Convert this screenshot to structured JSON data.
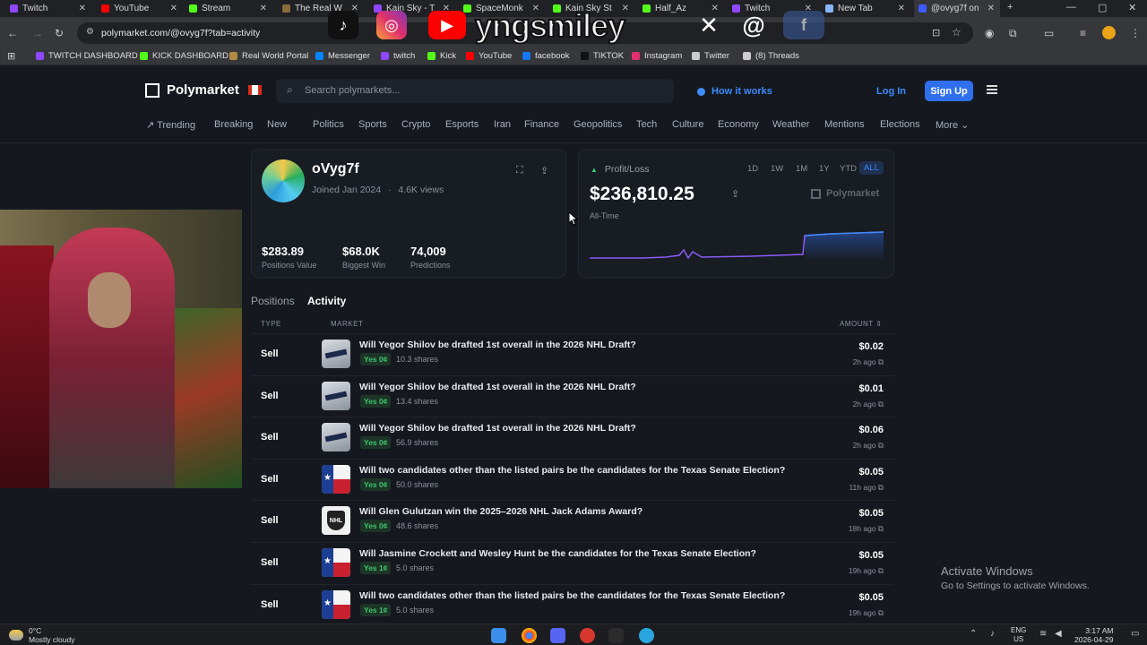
{
  "browser": {
    "tabs": [
      {
        "label": "Twitch",
        "color": "#9146ff"
      },
      {
        "label": "YouTube",
        "color": "#ff0000"
      },
      {
        "label": "Stream",
        "color": "#53fc18"
      },
      {
        "label": "The Real W",
        "color": "#8a6d3b"
      },
      {
        "label": "Kain Sky - T",
        "color": "#9146ff"
      },
      {
        "label": "SpaceMonk",
        "color": "#53fc18"
      },
      {
        "label": "Kain Sky St",
        "color": "#53fc18"
      },
      {
        "label": "Half_Az",
        "color": "#53fc18"
      },
      {
        "label": "Twitch",
        "color": "#9146ff"
      },
      {
        "label": "New Tab",
        "color": "#8ab4f8"
      },
      {
        "label": "@ovyg7f on",
        "color": "#3d5afe"
      }
    ],
    "url": "polymarket.com/@ovyg7f?tab=activity",
    "overlay_text": "yngsmiley",
    "bookmarks": [
      {
        "label": "TWITCH DASHBOARD",
        "color": "#9146ff"
      },
      {
        "label": "KICK DASHBOARD",
        "color": "#53fc18"
      },
      {
        "label": "Real World Portal",
        "color": "#b08a3e"
      },
      {
        "label": "Messenger",
        "color": "#0084ff"
      },
      {
        "label": "twitch",
        "color": "#9146ff"
      },
      {
        "label": "Kick",
        "color": "#53fc18"
      },
      {
        "label": "YouTube",
        "color": "#ff0000"
      },
      {
        "label": "facebook",
        "color": "#1877f2"
      },
      {
        "label": "TIKTOK",
        "color": "#111111"
      },
      {
        "label": "Instagram",
        "color": "#e1306c"
      },
      {
        "label": "Twitter",
        "color": "#cccccc"
      },
      {
        "label": "(8) Threads",
        "color": "#cccccc"
      }
    ]
  },
  "site": {
    "brand": "Polymarket",
    "search_placeholder": "Search polymarkets...",
    "how_it_works": "How it works",
    "login": "Log In",
    "signup": "Sign Up",
    "categories": [
      "Trending",
      "Breaking",
      "New",
      "Politics",
      "Sports",
      "Crypto",
      "Esports",
      "Iran",
      "Finance",
      "Geopolitics",
      "Tech",
      "Culture",
      "Economy",
      "Weather",
      "Mentions",
      "Elections",
      "More"
    ]
  },
  "profile": {
    "name": "oVyg7f",
    "joined": "Joined Jan 2024",
    "views": "4.6K views",
    "stats": [
      {
        "value": "$283.89",
        "label": "Positions Value"
      },
      {
        "value": "$68.0K",
        "label": "Biggest Win"
      },
      {
        "value": "74,009",
        "label": "Predictions"
      }
    ]
  },
  "pnl": {
    "title": "Profit/Loss",
    "ranges": [
      "1D",
      "1W",
      "1M",
      "1Y",
      "YTD",
      "ALL"
    ],
    "selected_range": "ALL",
    "value": "$236,810.25",
    "brand": "Polymarket",
    "period": "All-Time",
    "accent_color": "#3d8bfd"
  },
  "tabs": {
    "positions": "Positions",
    "activity": "Activity",
    "selected": "Activity"
  },
  "activity": {
    "headers": {
      "type": "TYPE",
      "market": "MARKET",
      "amount": "AMOUNT"
    },
    "rows": [
      {
        "type": "Sell",
        "thumb": "hockey",
        "title": "Will Yegor Shilov be drafted 1st overall in the 2026 NHL Draft?",
        "outcome": "Yes 0¢",
        "shares": "10.3 shares",
        "amount": "$0.02",
        "ago": "2h ago"
      },
      {
        "type": "Sell",
        "thumb": "hockey",
        "title": "Will Yegor Shilov be drafted 1st overall in the 2026 NHL Draft?",
        "outcome": "Yes 0¢",
        "shares": "13.4 shares",
        "amount": "$0.01",
        "ago": "2h ago"
      },
      {
        "type": "Sell",
        "thumb": "hockey",
        "title": "Will Yegor Shilov be drafted 1st overall in the 2026 NHL Draft?",
        "outcome": "Yes 0¢",
        "shares": "56.9 shares",
        "amount": "$0.06",
        "ago": "2h ago"
      },
      {
        "type": "Sell",
        "thumb": "texas",
        "title": "Will two candidates other than the listed pairs be the candidates for the Texas Senate Election?",
        "outcome": "Yes 0¢",
        "shares": "50.0 shares",
        "amount": "$0.05",
        "ago": "11h ago"
      },
      {
        "type": "Sell",
        "thumb": "nhl",
        "title": "Will Glen Gulutzan win the 2025–2026 NHL Jack Adams Award?",
        "outcome": "Yes 0¢",
        "shares": "48.6 shares",
        "amount": "$0.05",
        "ago": "18h ago"
      },
      {
        "type": "Sell",
        "thumb": "texas",
        "title": "Will Jasmine Crockett and Wesley Hunt be the candidates for the Texas Senate Election?",
        "outcome": "Yes 1¢",
        "shares": "5.0 shares",
        "amount": "$0.05",
        "ago": "19h ago"
      },
      {
        "type": "Sell",
        "thumb": "texas",
        "title": "Will two candidates other than the listed pairs be the candidates for the Texas Senate Election?",
        "outcome": "Yes 1¢",
        "shares": "5.0 shares",
        "amount": "$0.05",
        "ago": "19h ago"
      }
    ]
  },
  "windows": {
    "activate_title": "Activate Windows",
    "activate_sub": "Go to Settings to activate Windows.",
    "weather_temp": "0°C",
    "weather_desc": "Mostly cloudy",
    "lang": "ENG",
    "region": "US",
    "time": "3:17 AM",
    "date": "2026-04-29"
  }
}
